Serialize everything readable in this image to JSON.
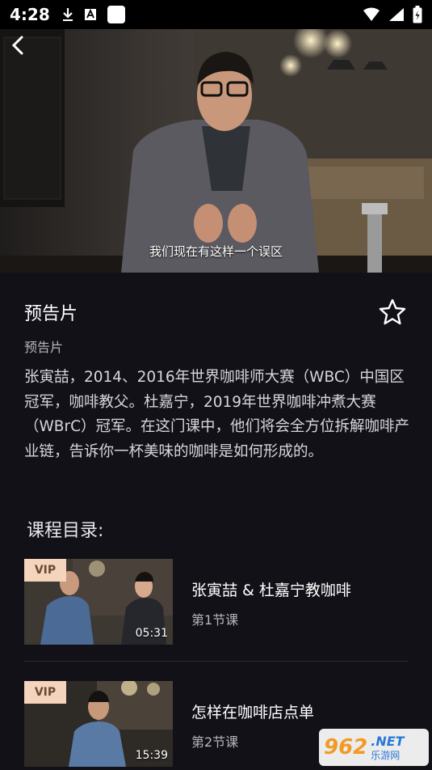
{
  "status_bar": {
    "time": "4:28"
  },
  "video": {
    "subtitle": "我们现在有这样一个误区"
  },
  "course": {
    "title": "预告片",
    "tag": "预告片",
    "description": "张寅喆，2014、2016年世界咖啡师大赛（WBC）中国区冠军，咖啡教父。杜嘉宁，2019年世界咖啡冲煮大赛（WBrC）冠军。在这门课中，他们将会全方位拆解咖啡产业链，告诉你一杯美味的咖啡是如何形成的。"
  },
  "catalog": {
    "heading": "课程目录:",
    "lessons": [
      {
        "badge": "VIP",
        "duration": "05:31",
        "title": "张寅喆 & 杜嘉宁教咖啡",
        "subtitle": "第1节课"
      },
      {
        "badge": "VIP",
        "duration": "15:39",
        "title": "怎样在咖啡店点单",
        "subtitle": "第2节课"
      }
    ]
  },
  "watermark": {
    "number": "962",
    "net": ".NET",
    "site": "乐游网"
  },
  "colors": {
    "background": "#131118",
    "vip_badge": "#f4d4bd",
    "muted_text": "#b8b6bc"
  }
}
